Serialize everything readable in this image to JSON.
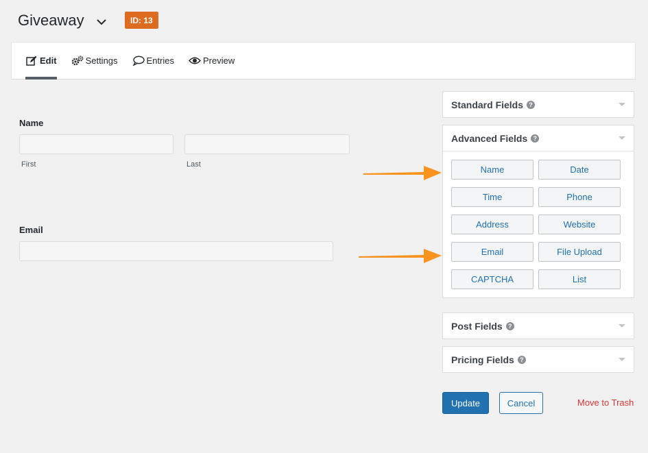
{
  "header": {
    "form_title": "Giveaway",
    "id_badge": "ID: 13"
  },
  "toolbar": {
    "tabs": [
      {
        "label": "Edit",
        "icon": "edit-icon",
        "active": true
      },
      {
        "label": "Settings",
        "icon": "gears-icon",
        "active": false
      },
      {
        "label": "Entries",
        "icon": "comment-icon",
        "active": false
      },
      {
        "label": "Preview",
        "icon": "eye-icon",
        "active": false
      }
    ]
  },
  "form": {
    "name_label": "Name",
    "first_sublabel": "First",
    "last_sublabel": "Last",
    "email_label": "Email"
  },
  "panels": {
    "standard": {
      "title": "Standard Fields"
    },
    "advanced": {
      "title": "Advanced Fields",
      "buttons": [
        "Name",
        "Date",
        "Time",
        "Phone",
        "Address",
        "Website",
        "Email",
        "File Upload",
        "CAPTCHA",
        "List"
      ]
    },
    "post": {
      "title": "Post Fields"
    },
    "pricing": {
      "title": "Pricing Fields"
    }
  },
  "actions": {
    "update": "Update",
    "cancel": "Cancel",
    "trash": "Move to Trash"
  },
  "colors": {
    "accent": "#2271b1",
    "badge": "#dd6b20",
    "arrow": "#f7931e",
    "danger": "#d63638"
  }
}
